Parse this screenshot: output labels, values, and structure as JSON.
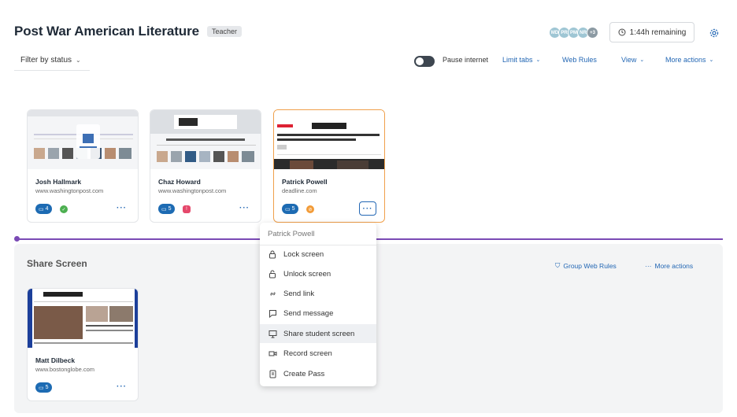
{
  "header": {
    "title": "Post War American Literature",
    "role_badge": "Teacher"
  },
  "avatars": [
    "MD",
    "PR",
    "PM",
    "NR",
    "+3"
  ],
  "timer": {
    "label": "1:44h remaining",
    "icon": "clock-icon"
  },
  "filter": {
    "label": "Filter by status"
  },
  "toolbar": {
    "pause_label": "Pause internet",
    "pause_enabled": false,
    "limit_tabs": "Limit tabs",
    "web_rules": "Web Rules",
    "view": "View",
    "more_actions": "More actions"
  },
  "students": [
    {
      "name": "Josh Hallmark",
      "url": "www.washingtonpost.com",
      "tabs": "4",
      "status": "ok",
      "status_color": "#4caf50"
    },
    {
      "name": "Chaz Howard",
      "url": "www.washingtonpost.com",
      "tabs": "5",
      "status": "warning",
      "status_color": "#e5486b"
    },
    {
      "name": "Patrick Powell",
      "url": "deadline.com",
      "tabs": "5",
      "status": "blocked",
      "status_color": "#f29b38",
      "selected": true
    }
  ],
  "share": {
    "title": "Share Screen",
    "group_web_rules": "Group Web Rules",
    "more_actions": "More actions",
    "student": {
      "name": "Matt Dilbeck",
      "url": "www.bostonglobe.com",
      "tabs": "5"
    }
  },
  "menu": {
    "header": "Patrick Powell",
    "items": [
      {
        "label": "Lock screen",
        "icon": "lock-icon"
      },
      {
        "label": "Unlock screen",
        "icon": "unlock-icon"
      },
      {
        "label": "Send link",
        "icon": "link-icon"
      },
      {
        "label": "Send message",
        "icon": "message-icon"
      },
      {
        "label": "Share student screen",
        "icon": "monitor-icon",
        "hover": true
      },
      {
        "label": "Record screen",
        "icon": "video-icon"
      },
      {
        "label": "Create Pass",
        "icon": "pass-icon"
      }
    ]
  },
  "colors": {
    "accent": "#2367b4",
    "divider": "#7a4ab5",
    "selected_border": "#f0a04b"
  }
}
